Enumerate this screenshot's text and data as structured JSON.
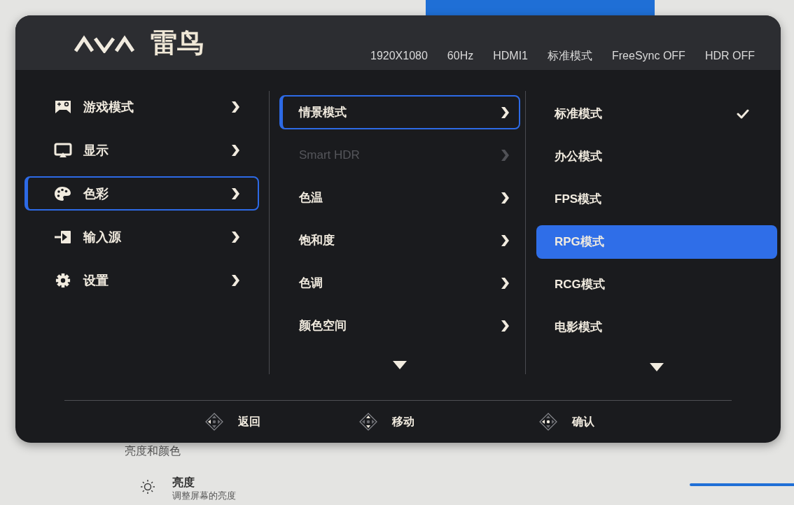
{
  "background": {
    "section_heading": "亮度和颜色",
    "setting": {
      "title": "亮度",
      "description": "调整屏幕的亮度"
    }
  },
  "osd": {
    "brand": "雷鸟",
    "status": [
      "1920X1080",
      "60Hz",
      "HDMI1",
      "标准模式",
      "FreeSync OFF",
      "HDR OFF"
    ],
    "main_menu": [
      {
        "label": "游戏模式",
        "selected": false
      },
      {
        "label": "显示",
        "selected": false
      },
      {
        "label": "色彩",
        "selected": true
      },
      {
        "label": "输入源",
        "selected": false
      },
      {
        "label": "设置",
        "selected": false
      }
    ],
    "submenu": {
      "items": [
        {
          "label": "情景模式",
          "selected": true,
          "disabled": false
        },
        {
          "label": "Smart HDR",
          "selected": false,
          "disabled": true
        },
        {
          "label": "色温",
          "selected": false,
          "disabled": false
        },
        {
          "label": "饱和度",
          "selected": false,
          "disabled": false
        },
        {
          "label": "色调",
          "selected": false,
          "disabled": false
        },
        {
          "label": "颜色空间",
          "selected": false,
          "disabled": false
        }
      ],
      "more_below": true
    },
    "options": {
      "items": [
        {
          "label": "标准模式",
          "selected": false,
          "checked": true
        },
        {
          "label": "办公模式",
          "selected": false,
          "checked": false
        },
        {
          "label": "FPS模式",
          "selected": false,
          "checked": false
        },
        {
          "label": "RPG模式",
          "selected": true,
          "checked": false
        },
        {
          "label": "RCG模式",
          "selected": false,
          "checked": false
        },
        {
          "label": "电影模式",
          "selected": false,
          "checked": false
        }
      ],
      "more_below": true
    },
    "hints": [
      "返回",
      "移动",
      "确认"
    ]
  }
}
